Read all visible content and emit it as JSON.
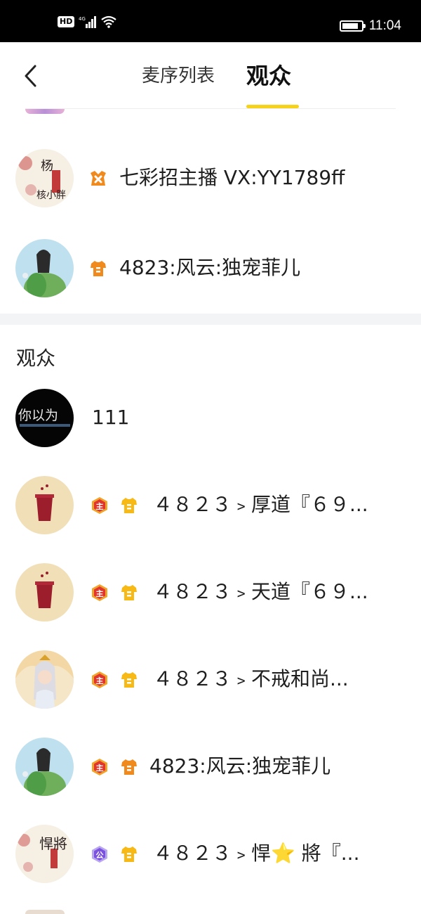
{
  "status_bar": {
    "hd": "HD",
    "network": "4G",
    "time": "11:04",
    "battery_level": 0.85,
    "icons": [
      "hd-icon",
      "signal-icon",
      "wifi-icon",
      "battery-icon"
    ]
  },
  "header": {
    "tabs": [
      {
        "label": "麦序列表",
        "active": false
      },
      {
        "label": "观众",
        "active": true
      }
    ],
    "accent_color": "#f7d21a"
  },
  "mic_list": [
    {
      "name": "七彩招主播 VX:YY1789ff",
      "badges": [
        "orange-crown-badge-icon"
      ]
    },
    {
      "name": "4823:风云:独宠菲儿",
      "badges": [
        "orange-shirt-badge-icon"
      ]
    }
  ],
  "audience": {
    "section_title": "观众",
    "items": [
      {
        "name": "111",
        "badges": []
      },
      {
        "name": "４８２３﹥厚道『６９...",
        "badges": [
          "host-badge-icon",
          "yellow-shirt-badge-icon"
        ],
        "badge_text": "主"
      },
      {
        "name": "４８２３﹥天道『６９...",
        "badges": [
          "host-badge-icon",
          "yellow-shirt-badge-icon"
        ],
        "badge_text": "主"
      },
      {
        "name": "４８２３﹥不戒和尚...",
        "badges": [
          "host-badge-icon",
          "yellow-shirt-badge-icon"
        ],
        "badge_text": "主"
      },
      {
        "name": "4823:风云:独宠菲儿",
        "badges": [
          "host-badge-icon",
          "orange-shirt-badge-icon"
        ],
        "badge_text": "主"
      },
      {
        "name": "４８２３﹥悍⭐ 將『...",
        "badges": [
          "public-badge-icon",
          "yellow-shirt-badge-icon"
        ],
        "badge_text": "公"
      }
    ]
  },
  "avatar_text": {
    "calligraphy_1": "杨",
    "calligraphy_2": "核小胖",
    "calligraphy_3": "悍將",
    "dark_avatar": "你以为"
  }
}
